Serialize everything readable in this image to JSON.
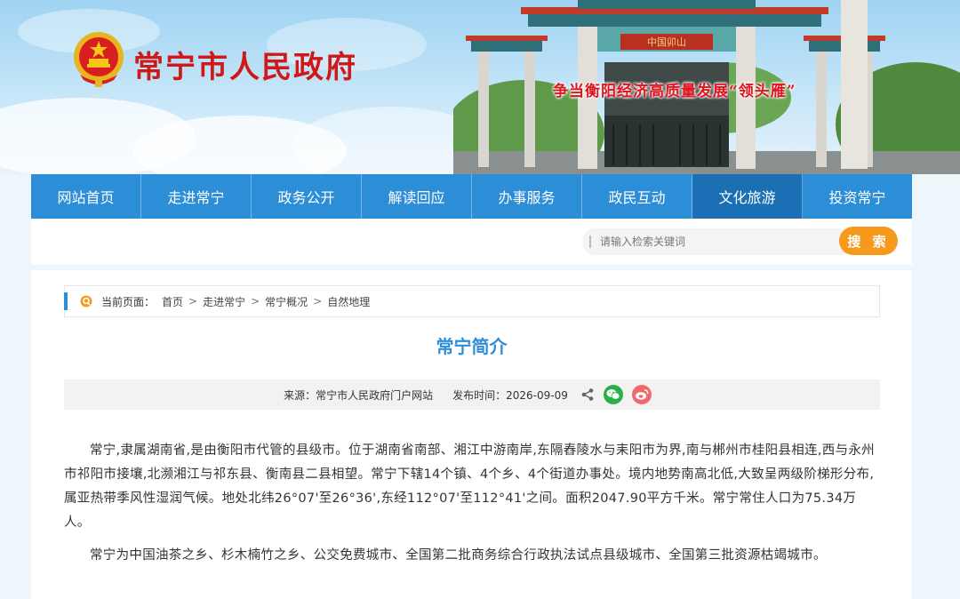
{
  "header": {
    "site_title": "常宁市人民政府",
    "slogan": "争当衡阳经济高质量发展“领头雁”",
    "gate_plaque": "中国卯山"
  },
  "nav": {
    "items": [
      {
        "label": "网站首页"
      },
      {
        "label": "走进常宁"
      },
      {
        "label": "政务公开"
      },
      {
        "label": "解读回应"
      },
      {
        "label": "办事服务"
      },
      {
        "label": "政民互动"
      },
      {
        "label": "文化旅游"
      },
      {
        "label": "投资常宁"
      }
    ],
    "active_index": 6
  },
  "search": {
    "placeholder": "请输入检索关键词",
    "button_label": "搜 索"
  },
  "breadcrumb": {
    "label": "当前页面：",
    "items": [
      "首页",
      "走进常宁",
      "常宁概况",
      "自然地理"
    ],
    "separator": ">"
  },
  "article": {
    "title": "常宁简介",
    "source": "来源：常宁市人民政府门户网站",
    "date": "发布时间：2026-09-09",
    "paragraphs": [
      "常宁,隶属湖南省,是由衡阳市代管的县级市。位于湖南省南部、湘江中游南岸,东隔舂陵水与耒阳市为界,南与郴州市桂阳县相连,西与永州市祁阳市接壤,北濒湘江与祁东县、衡南县二县相望。常宁下辖14个镇、4个乡、4个街道办事处。境内地势南高北低,大致呈两级阶梯形分布,属亚热带季风性湿润气候。地处北纬26°07'至26°36',东经112°07'至112°41'之间。面积2047.90平方千米。常宁常住人口为75.34万人。",
      "常宁为中国油茶之乡、杉木楠竹之乡、公交免费城市、全国第二批商务综合行政执法试点县级城市、全国第三批资源枯竭城市。"
    ]
  },
  "colors": {
    "nav_bg": "#2d8ed8",
    "nav_active": "#1a6fb5",
    "title_blue": "#2d8ed8",
    "search_button": "#f59a1c",
    "site_title_red": "#d01818",
    "wechat": "#2ab04a",
    "weibo": "#ef6b6b"
  },
  "icons": {
    "emblem": "national-emblem-icon",
    "breadcrumb": "location-icon",
    "share": "share-icon",
    "wechat": "wechat-icon",
    "weibo": "weibo-icon"
  }
}
